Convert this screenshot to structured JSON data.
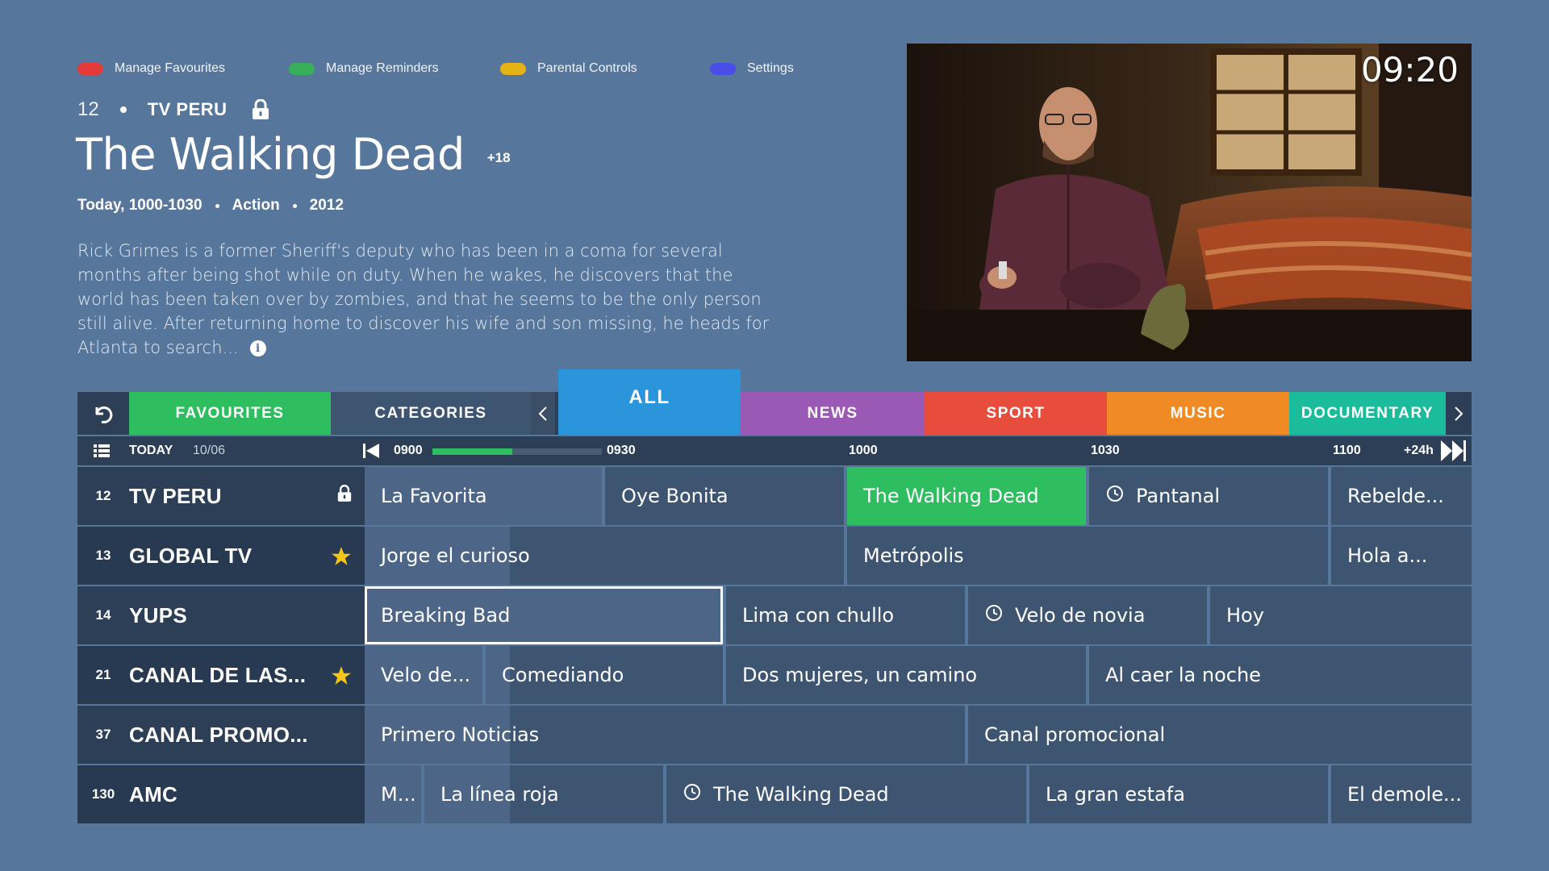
{
  "legend": [
    {
      "label": "Manage Favourites",
      "color": "#e53a3a"
    },
    {
      "label": "Manage Reminders",
      "color": "#38b05a"
    },
    {
      "label": "Parental Controls",
      "color": "#e5b316"
    },
    {
      "label": "Settings",
      "color": "#4a4ee8"
    }
  ],
  "current": {
    "channel_number": "12",
    "channel_name": "TV PERU",
    "title": "The Walking Dead",
    "rating": "+18",
    "time": "Today, 1000-1030",
    "genre": "Action",
    "year": "2012",
    "description": "Rick Grimes is a former Sheriff's deputy who has been in a coma for several months after being shot while on duty. When he wakes, he discovers that the world has been taken over by zombies, and that he seems to be the only person still alive. After returning home to discover his wife and son missing, he heads for Atlanta to search...",
    "info_glyph": "i"
  },
  "preview": {
    "clock": "09:20"
  },
  "tabs": {
    "favourites": "FAVOURITES",
    "categories": "CATEGORIES",
    "all": "ALL",
    "news": "NEWS",
    "sport": "SPORT",
    "music": "MUSIC",
    "documentary": "DOCUMENTARY",
    "colors": {
      "favourites": "#2ebd5f",
      "categories": "#3e5572",
      "all": "#2b95dc",
      "news": "#9b59b6",
      "sport": "#e74c3c",
      "music": "#f08a24",
      "documentary": "#1abc9c"
    }
  },
  "timebar": {
    "day": "TODAY",
    "date": "10/06",
    "times": [
      "0900",
      "0930",
      "1000",
      "1030",
      "1100"
    ],
    "plus24": "+24h",
    "progress_fraction": 0.47
  },
  "channels": [
    {
      "number": "12",
      "name": "TV PERU",
      "badge": "lock",
      "programs": [
        "La Favorita",
        "Oye Bonita",
        "The Walking Dead",
        "Pantanal",
        "Rebelde..."
      ]
    },
    {
      "number": "13",
      "name": "GLOBAL TV",
      "badge": "star",
      "programs": [
        "Jorge el curioso",
        "Metrópolis",
        "Hola a..."
      ]
    },
    {
      "number": "14",
      "name": "YUPS",
      "badge": "",
      "programs": [
        "Breaking Bad",
        "Lima con chullo",
        "Velo de novia",
        "Hoy"
      ]
    },
    {
      "number": "21",
      "name": "CANAL DE LAS...",
      "badge": "star",
      "programs": [
        "Velo de...",
        "Comediando",
        "Dos mujeres, un camino",
        "Al caer la noche"
      ]
    },
    {
      "number": "37",
      "name": "CANAL PROMO...",
      "badge": "",
      "programs": [
        "Primero Noticias",
        "Canal promocional"
      ]
    },
    {
      "number": "130",
      "name": "AMC",
      "badge": "",
      "programs": [
        "M...",
        "La línea roja",
        "The Walking Dead",
        "La gran estafa",
        "El demole..."
      ]
    }
  ]
}
